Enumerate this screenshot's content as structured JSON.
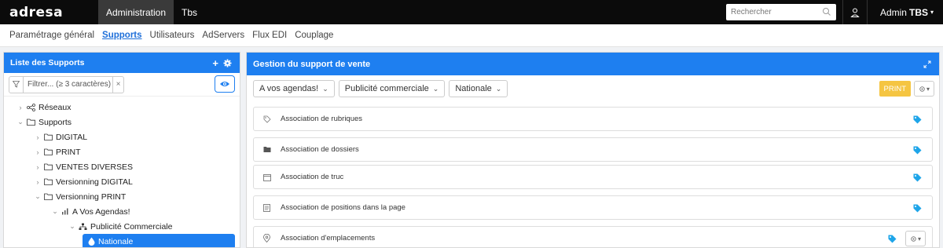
{
  "topbar": {
    "logo": "adresa",
    "nav": [
      {
        "label": "Administration",
        "active": true
      },
      {
        "label": "Tbs",
        "active": false
      }
    ],
    "search_placeholder": "Rechercher",
    "user_prefix": "Admin",
    "user_name": "TBS"
  },
  "subnav": [
    {
      "label": "Paramétrage général",
      "active": false
    },
    {
      "label": "Supports",
      "active": true
    },
    {
      "label": "Utilisateurs",
      "active": false
    },
    {
      "label": "AdServers",
      "active": false
    },
    {
      "label": "Flux EDI",
      "active": false
    },
    {
      "label": "Couplage",
      "active": false
    }
  ],
  "left_panel": {
    "title": "Liste des Supports",
    "add_symbol": "+",
    "filter_placeholder": "Filtrer... (≥ 3 caractères)",
    "tree": [
      {
        "label": "Réseaux",
        "expanded": false,
        "icon": "share-icon"
      },
      {
        "label": "Supports",
        "expanded": true,
        "icon": "folder-icon"
      },
      {
        "label": "DIGITAL",
        "expanded": false,
        "icon": "folder-icon"
      },
      {
        "label": "PRINT",
        "expanded": false,
        "icon": "folder-icon"
      },
      {
        "label": "VENTES DIVERSES",
        "expanded": false,
        "icon": "folder-icon"
      },
      {
        "label": "Versionning DIGITAL",
        "expanded": false,
        "icon": "folder-icon"
      },
      {
        "label": "Versionning PRINT",
        "expanded": true,
        "icon": "folder-icon"
      },
      {
        "label": "A Vos Agendas!",
        "expanded": true,
        "icon": "bars-icon"
      },
      {
        "label": "Publicité Commerciale",
        "expanded": true,
        "icon": "sitemap-icon"
      },
      {
        "label": "Nationale",
        "selected": true,
        "icon": "drop-icon"
      }
    ]
  },
  "right_panel": {
    "title": "Gestion du support de vente",
    "dropdowns": [
      "A vos agendas!",
      "Publicité commerciale",
      "Nationale"
    ],
    "badge": "PRINT",
    "associations": [
      {
        "label": "Association de rubriques",
        "icon": "tag-outline-icon"
      },
      {
        "label": "Association de dossiers",
        "icon": "folder-solid-icon"
      },
      {
        "label": "Association de truc",
        "icon": "calendar-icon"
      },
      {
        "label": "Association de positions dans la page",
        "icon": "document-icon"
      },
      {
        "label": "Association d'emplacements",
        "icon": "map-pin-icon"
      }
    ]
  },
  "colors": {
    "accent": "#1e7ff0",
    "badge": "#f5c542",
    "tag": "#1ea5e9",
    "topbar": "#0b0b0b"
  }
}
